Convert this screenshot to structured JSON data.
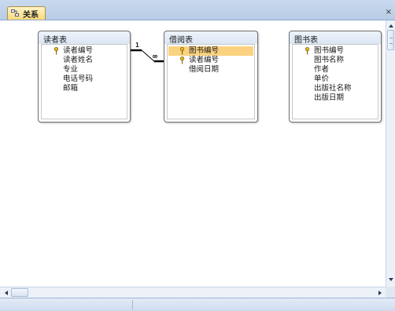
{
  "tab": {
    "label": "关系",
    "icon": "relationships-icon"
  },
  "window": {
    "close_glyph": "×"
  },
  "tables": [
    {
      "title": "读者表",
      "fields": [
        {
          "name": "读者编号",
          "key": true,
          "selected": false
        },
        {
          "name": "读者姓名",
          "key": false,
          "selected": false
        },
        {
          "name": "专业",
          "key": false,
          "selected": false
        },
        {
          "name": "电话号码",
          "key": false,
          "selected": false
        },
        {
          "name": "邮箱",
          "key": false,
          "selected": false
        }
      ]
    },
    {
      "title": "借阅表",
      "fields": [
        {
          "name": "图书编号",
          "key": true,
          "selected": true
        },
        {
          "name": "读者编号",
          "key": true,
          "selected": false
        },
        {
          "name": "借阅日期",
          "key": false,
          "selected": false
        }
      ]
    },
    {
      "title": "图书表",
      "fields": [
        {
          "name": "图书编号",
          "key": true,
          "selected": false
        },
        {
          "name": "图书名称",
          "key": false,
          "selected": false
        },
        {
          "name": "作者",
          "key": false,
          "selected": false
        },
        {
          "name": "单价",
          "key": false,
          "selected": false
        },
        {
          "name": "出版社名称",
          "key": false,
          "selected": false
        },
        {
          "name": "出版日期",
          "key": false,
          "selected": false
        }
      ]
    }
  ],
  "relationship": {
    "one_side": "1",
    "many_side": "∞"
  },
  "colors": {
    "selection": "#fbd27f",
    "tab": "#f8d978",
    "chrome": "#b8cce6"
  }
}
